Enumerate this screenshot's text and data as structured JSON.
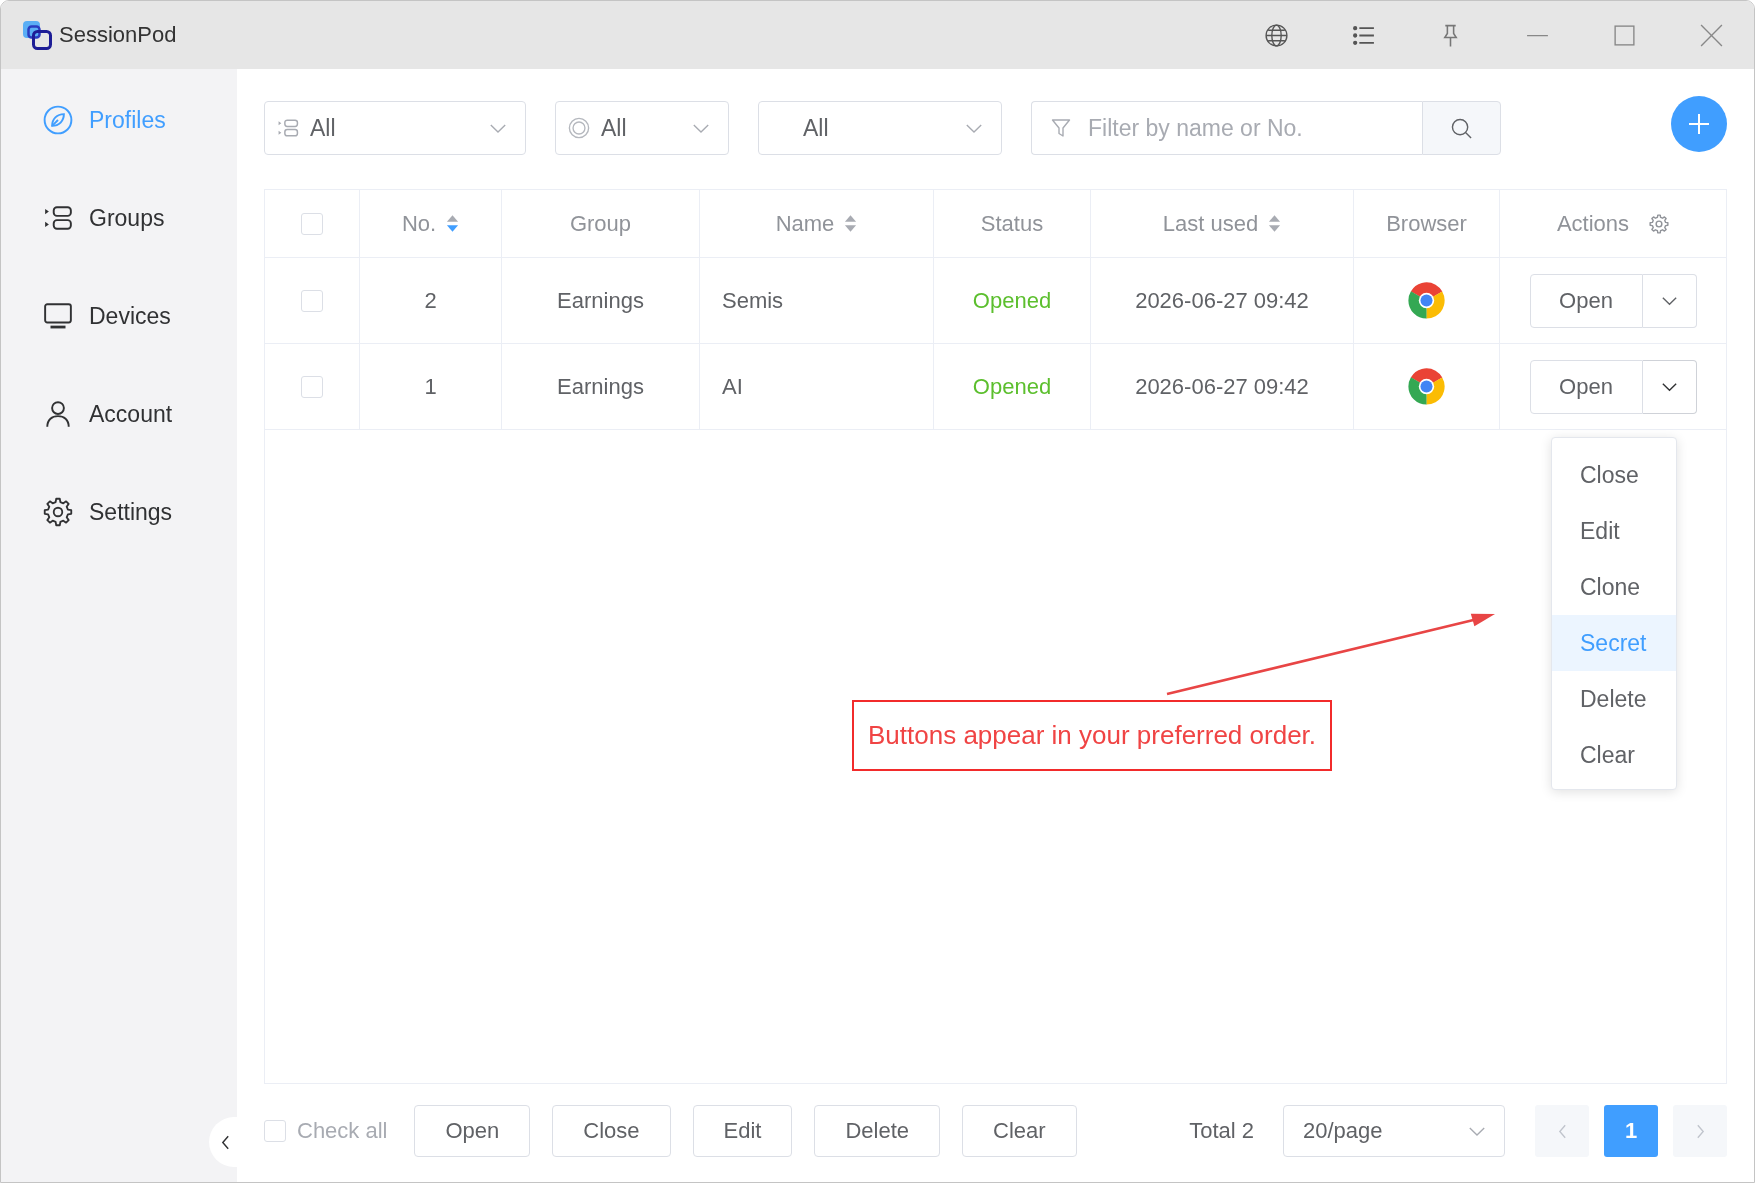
{
  "window": {
    "title": "SessionPod"
  },
  "sidebar": {
    "items": [
      {
        "label": "Profiles",
        "selected": true
      },
      {
        "label": "Groups",
        "selected": false
      },
      {
        "label": "Devices",
        "selected": false
      },
      {
        "label": "Account",
        "selected": false
      },
      {
        "label": "Settings",
        "selected": false
      }
    ]
  },
  "toolbar": {
    "filters": [
      {
        "value": "All"
      },
      {
        "value": "All"
      },
      {
        "value": "All"
      }
    ],
    "search": {
      "placeholder": "Filter by name or No."
    }
  },
  "table": {
    "columns": [
      {
        "kind": "checkbox",
        "checked": false
      },
      {
        "kind": "text",
        "label": "No.",
        "sorted": true
      },
      {
        "kind": "text",
        "label": "Group"
      },
      {
        "kind": "text",
        "label": "Name",
        "sorted": false
      },
      {
        "kind": "text",
        "label": "Status"
      },
      {
        "kind": "text",
        "label": "Last used",
        "sorted": false
      },
      {
        "kind": "text",
        "label": "Browser"
      },
      {
        "kind": "actions",
        "label": "Actions"
      }
    ],
    "rows": [
      {
        "checked": false,
        "no": "2",
        "group": "Earnings",
        "name": "Semis",
        "status": "Opened",
        "status_active": true,
        "last_used": "2026-06-27 09:42",
        "action": "Open",
        "expanded": false
      },
      {
        "checked": false,
        "no": "1",
        "group": "Earnings",
        "name": "AI",
        "status": "Opened",
        "status_active": true,
        "last_used": "2026-06-27 09:42",
        "action": "Open",
        "expanded": true,
        "menu": [
          {
            "label": "Close",
            "selected": false
          },
          {
            "label": "Edit",
            "selected": false
          },
          {
            "label": "Clone",
            "selected": false
          },
          {
            "label": "Secret",
            "selected": true
          },
          {
            "label": "Delete",
            "selected": false
          },
          {
            "label": "Clear",
            "selected": false
          }
        ]
      }
    ]
  },
  "annotation": {
    "text": "Buttons appear in your preferred order."
  },
  "bottom_bar": {
    "check_all": {
      "label": "Check all",
      "checked": false
    },
    "buttons": [
      "Open",
      "Close",
      "Edit",
      "Delete",
      "Clear"
    ],
    "pagination": {
      "total": "Total 2",
      "page_size": "20/page",
      "prev_disabled": true,
      "pages": [
        {
          "label": "1",
          "selected": true
        }
      ],
      "next_disabled": true
    }
  }
}
